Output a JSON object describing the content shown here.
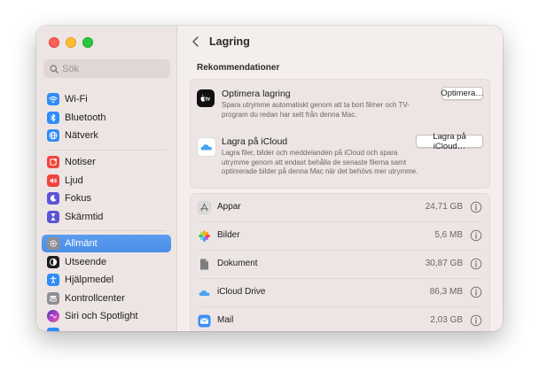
{
  "search": {
    "placeholder": "Sök"
  },
  "sidebar": {
    "items": [
      {
        "label": "Wi-Fi",
        "icon": "wifi-icon",
        "color": "#2f8cf7"
      },
      {
        "label": "Bluetooth",
        "icon": "bluetooth-icon",
        "color": "#2f8cf7"
      },
      {
        "label": "Nätverk",
        "icon": "globe-icon",
        "color": "#2f8cf7"
      },
      {
        "label": "Notiser",
        "icon": "bell-icon",
        "color": "#f0443c"
      },
      {
        "label": "Ljud",
        "icon": "speaker-icon",
        "color": "#f0443c"
      },
      {
        "label": "Fokus",
        "icon": "moon-icon",
        "color": "#5a55d6"
      },
      {
        "label": "Skärmtid",
        "icon": "hourglass-icon",
        "color": "#5a55d6"
      },
      {
        "label": "Allmänt",
        "icon": "gear-icon",
        "color": "#8e8e93",
        "selected": true
      },
      {
        "label": "Utseende",
        "icon": "appearance-icon",
        "color": "#1d1d1f"
      },
      {
        "label": "Hjälpmedel",
        "icon": "accessibility-icon",
        "color": "#2f8cf7"
      },
      {
        "label": "Kontrollcenter",
        "icon": "control-center-icon",
        "color": "#8e8e93"
      },
      {
        "label": "Siri och Spotlight",
        "icon": "siri-icon",
        "color": "#b041d1"
      }
    ]
  },
  "header": {
    "title": "Lagring"
  },
  "recommendations": {
    "label": "Rekommendationer",
    "items": [
      {
        "title": "Optimera lagring",
        "description": "Spara utrymme automatiskt genom att ta bort filmer och TV-program du redan har sett från denna Mac.",
        "button": "Optimera…",
        "icon": "apple-tv-icon"
      },
      {
        "title": "Lagra på iCloud",
        "description": "Lagra filer, bilder och meddelanden på iCloud och spara utrymme genom att endast behålla de senaste filerna samt optimerade bilder på denna Mac när det behövs mer utrymme.",
        "button": "Lagra på iCloud…",
        "icon": "icloud-icon"
      }
    ]
  },
  "storage": {
    "items": [
      {
        "name": "Appar",
        "size": "24,71 GB",
        "icon": "app-store-icon"
      },
      {
        "name": "Bilder",
        "size": "5,6 MB",
        "icon": "photos-icon"
      },
      {
        "name": "Dokument",
        "size": "30,87 GB",
        "icon": "document-icon"
      },
      {
        "name": "iCloud Drive",
        "size": "86,3 MB",
        "icon": "icloud-drive-icon"
      },
      {
        "name": "Mail",
        "size": "2,03 GB",
        "icon": "mail-icon"
      }
    ]
  }
}
